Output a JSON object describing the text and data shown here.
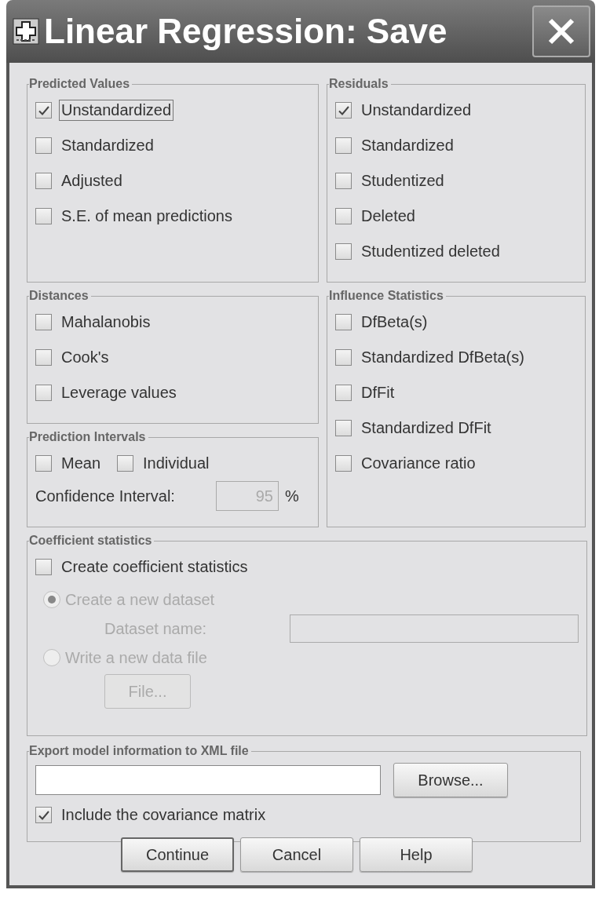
{
  "window": {
    "title": "Linear Regression: Save"
  },
  "predicted_values": {
    "title": "Predicted Values",
    "options": [
      {
        "label": "Unstandardized",
        "checked": true,
        "focused": true
      },
      {
        "label": "Standardized",
        "checked": false,
        "focused": false
      },
      {
        "label": "Adjusted",
        "checked": false,
        "focused": false
      },
      {
        "label": "S.E. of mean predictions",
        "checked": false,
        "focused": false
      }
    ]
  },
  "residuals": {
    "title": "Residuals",
    "options": [
      {
        "label": "Unstandardized",
        "checked": true
      },
      {
        "label": "Standardized",
        "checked": false
      },
      {
        "label": "Studentized",
        "checked": false
      },
      {
        "label": "Deleted",
        "checked": false
      },
      {
        "label": "Studentized deleted",
        "checked": false
      }
    ]
  },
  "distances": {
    "title": "Distances",
    "options": [
      {
        "label": "Mahalanobis",
        "checked": false
      },
      {
        "label": "Cook's",
        "checked": false
      },
      {
        "label": "Leverage values",
        "checked": false
      }
    ]
  },
  "influence_statistics": {
    "title": "Influence Statistics",
    "options": [
      {
        "label": "DfBeta(s)",
        "checked": false
      },
      {
        "label": "Standardized DfBeta(s)",
        "checked": false
      },
      {
        "label": "DfFit",
        "checked": false
      },
      {
        "label": "Standardized DfFit",
        "checked": false
      },
      {
        "label": "Covariance ratio",
        "checked": false
      }
    ]
  },
  "prediction_intervals": {
    "title": "Prediction Intervals",
    "options": [
      {
        "label": "Mean",
        "checked": false
      },
      {
        "label": "Individual",
        "checked": false
      }
    ],
    "confidence_label": "Confidence Interval:",
    "confidence_value": "95",
    "unit": "%",
    "confidence_disabled": true
  },
  "coefficient_statistics": {
    "title": "Coefficient statistics",
    "create": {
      "label": "Create coefficient statistics",
      "checked": false
    },
    "destinations": [
      {
        "label": "Create a new dataset",
        "selected": true,
        "disabled": true
      },
      {
        "label": "Write a new data file",
        "selected": false,
        "disabled": true
      }
    ],
    "dataset_name_label": "Dataset name:",
    "file_button": "File...",
    "details_disabled": true
  },
  "export_xml": {
    "title": "Export model information to XML file",
    "browse_button": "Browse...",
    "include": {
      "label": "Include the covariance matrix",
      "checked": true
    }
  },
  "buttons": [
    {
      "label": "Continue",
      "default": true
    },
    {
      "label": "Cancel",
      "default": false
    },
    {
      "label": "Help",
      "default": false
    }
  ]
}
